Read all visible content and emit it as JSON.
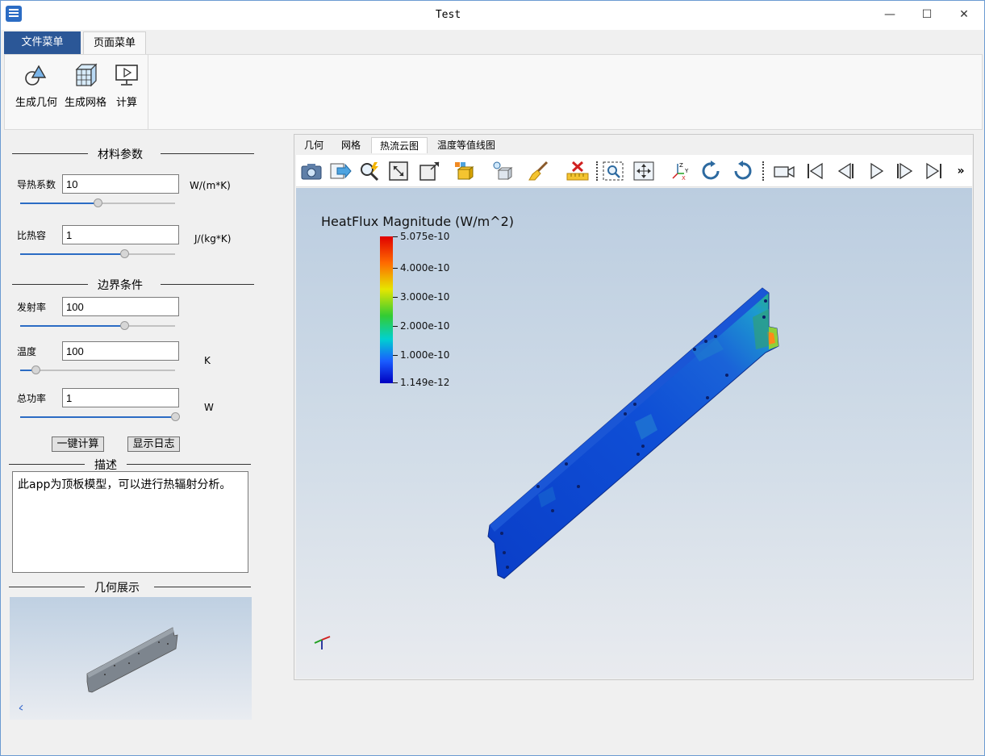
{
  "window": {
    "title": "Test"
  },
  "ribbon": {
    "tabs": [
      "文件菜单",
      "页面菜单"
    ],
    "buttons": [
      {
        "label": "生成几何",
        "icon": "geometry-icon"
      },
      {
        "label": "生成网格",
        "icon": "mesh-icon"
      },
      {
        "label": "计算",
        "icon": "compute-icon"
      }
    ]
  },
  "material": {
    "title": "材料参数",
    "conductivity": {
      "label": "导热系数",
      "value": "10",
      "unit": "W/(m*K)",
      "slider": 0.5
    },
    "heat_capacity": {
      "label": "比热容",
      "value": "1",
      "unit": "J/(kg*K)",
      "slider": 0.67
    }
  },
  "boundary": {
    "title": "边界条件",
    "emissivity": {
      "label": "发射率",
      "value": "100",
      "slider": 0.67
    },
    "temperature": {
      "label": "温度",
      "value": "100",
      "unit": "K",
      "slider": 0.1
    },
    "power": {
      "label": "总功率",
      "value": "1",
      "unit": "W",
      "slider": 1.0
    }
  },
  "actions": {
    "compute": "一键计算",
    "log": "显示日志"
  },
  "description": {
    "title": "描述",
    "text": "此app为顶板模型，可以进行热辐射分析。"
  },
  "preview": {
    "title": "几何展示"
  },
  "view_tabs": [
    "几何",
    "网格",
    "热流云图",
    "温度等值线图"
  ],
  "colorbar": {
    "title": "HeatFlux Magnitude (W/m^2)",
    "labels": [
      "5.075e-10",
      "4.000e-10",
      "3.000e-10",
      "2.000e-10",
      "1.000e-10",
      "1.149e-12"
    ]
  },
  "toolbar_icons": [
    "camera-icon",
    "export-icon",
    "zoom-icon",
    "fit-icon",
    "frame-icon",
    "display-mode-icon",
    "visibility-icon",
    "brush-icon",
    "ruler-icon",
    "zoom-region-icon",
    "move-icon",
    "axes-icon",
    "rotate-cw-icon",
    "rotate-ccw-icon",
    "camera-video-icon",
    "first-frame-icon",
    "prev-frame-icon",
    "play-icon",
    "next-frame-icon",
    "last-frame-icon",
    "more-icon"
  ]
}
